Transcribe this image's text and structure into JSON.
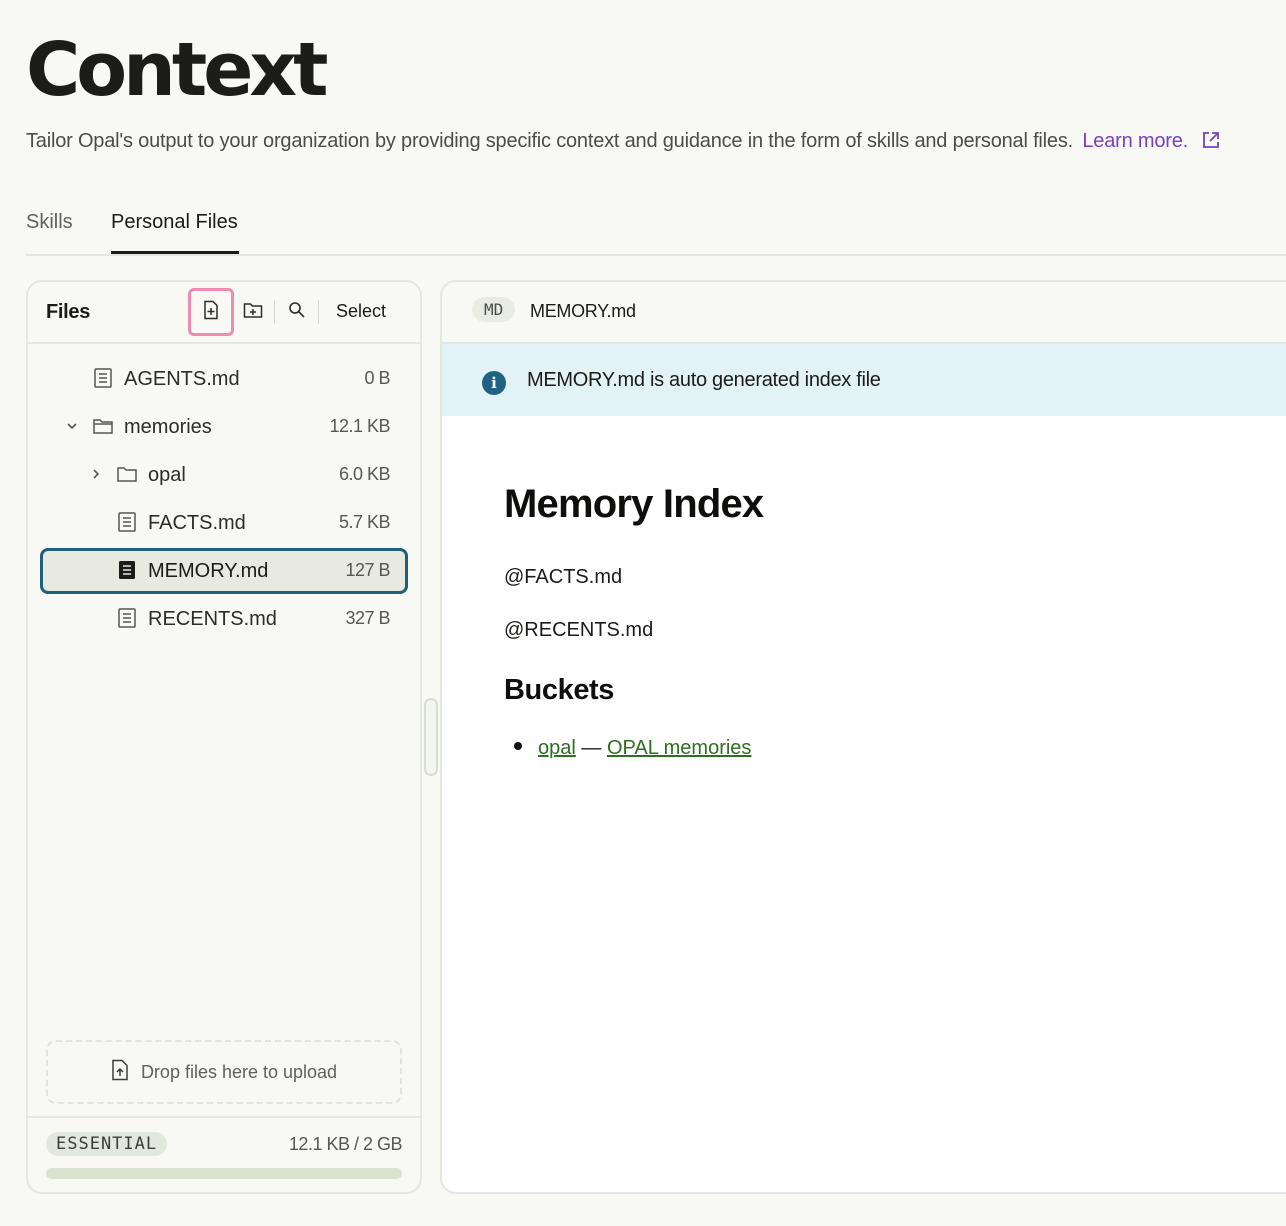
{
  "page": {
    "title": "Context",
    "subtitle": "Tailor Opal's output to your organization by providing specific context and guidance in the form of skills and personal files.",
    "learn_more": "Learn more."
  },
  "tabs": [
    {
      "label": "Skills",
      "active": false
    },
    {
      "label": "Personal Files",
      "active": true
    }
  ],
  "files_panel": {
    "title": "Files",
    "select_label": "Select",
    "toolbar_icons": [
      "new-file-icon",
      "new-folder-icon",
      "search-icon"
    ],
    "tree": [
      {
        "name": "AGENTS.md",
        "size": "0 B",
        "type": "file"
      },
      {
        "name": "memories",
        "size": "12.1 KB",
        "type": "folder",
        "expanded": true
      },
      {
        "name": "opal",
        "size": "6.0 KB",
        "type": "folder",
        "expanded": false
      },
      {
        "name": "FACTS.md",
        "size": "5.7 KB",
        "type": "file"
      },
      {
        "name": "MEMORY.md",
        "size": "127 B",
        "type": "file",
        "selected": true
      },
      {
        "name": "RECENTS.md",
        "size": "327 B",
        "type": "file"
      }
    ],
    "dropzone_label": "Drop files here to upload",
    "plan": "ESSENTIAL",
    "usage": "12.1 KB / 2 GB",
    "usage_fraction": 6e-06
  },
  "viewer": {
    "type_badge": "MD",
    "filename": "MEMORY.md",
    "info_banner": "MEMORY.md is auto generated index file",
    "doc": {
      "h1": "Memory Index",
      "p1": "@FACTS.md",
      "p2": "@RECENTS.md",
      "h2": "Buckets",
      "bullet_link1": "opal",
      "bullet_sep": " — ",
      "bullet_link2": "OPAL memories"
    }
  },
  "colors": {
    "accent_link": "#7a3fc2",
    "selected_border": "#1f5f7a",
    "info_bg": "#e2f2f5",
    "highlight_pink": "#f08ab0",
    "doc_link": "#2e6e20"
  }
}
